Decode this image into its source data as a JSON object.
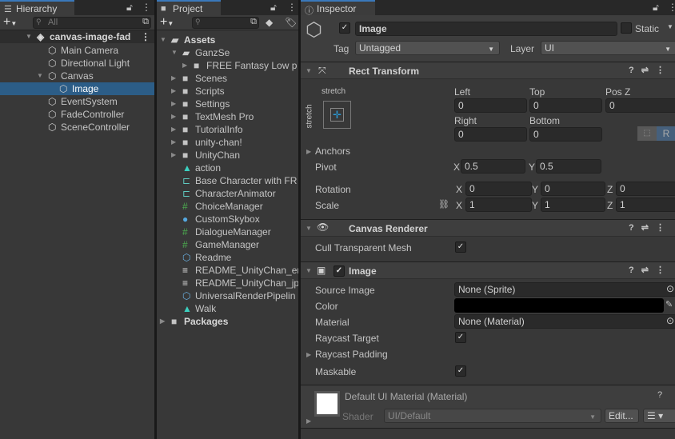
{
  "hierarchy": {
    "tab": "Hierarchy",
    "search_placeholder": "All",
    "items": [
      {
        "label": "canvas-image-fad",
        "depth": 0,
        "expanded": true,
        "icon": "unity-scene-icon",
        "bold": true
      },
      {
        "label": "Main Camera",
        "depth": 1,
        "icon": "cube-icon"
      },
      {
        "label": "Directional Light",
        "depth": 1,
        "icon": "cube-icon"
      },
      {
        "label": "Canvas",
        "depth": 1,
        "expanded": true,
        "icon": "cube-icon"
      },
      {
        "label": "Image",
        "depth": 2,
        "icon": "cube-icon",
        "selected": true
      },
      {
        "label": "EventSystem",
        "depth": 1,
        "icon": "cube-icon"
      },
      {
        "label": "FadeController",
        "depth": 1,
        "icon": "cube-icon"
      },
      {
        "label": "SceneController",
        "depth": 1,
        "icon": "cube-icon"
      }
    ]
  },
  "project": {
    "tab": "Project",
    "items": [
      {
        "label": "Assets",
        "depth": 0,
        "expanded": true,
        "icon": "folder-open-icon",
        "bold": true
      },
      {
        "label": "GanzSe",
        "depth": 1,
        "expanded": true,
        "icon": "folder-open-icon"
      },
      {
        "label": "FREE Fantasy Low p",
        "depth": 2,
        "collapsed": true,
        "icon": "folder-icon"
      },
      {
        "label": "Scenes",
        "depth": 1,
        "collapsed": true,
        "icon": "folder-icon"
      },
      {
        "label": "Scripts",
        "depth": 1,
        "collapsed": true,
        "icon": "folder-icon"
      },
      {
        "label": "Settings",
        "depth": 1,
        "collapsed": true,
        "icon": "folder-icon"
      },
      {
        "label": "TextMesh Pro",
        "depth": 1,
        "collapsed": true,
        "icon": "folder-icon"
      },
      {
        "label": "TutorialInfo",
        "depth": 1,
        "collapsed": true,
        "icon": "folder-icon"
      },
      {
        "label": "unity-chan!",
        "depth": 1,
        "collapsed": true,
        "icon": "folder-icon"
      },
      {
        "label": "UnityChan",
        "depth": 1,
        "collapsed": true,
        "icon": "folder-icon"
      },
      {
        "label": "action",
        "depth": 1,
        "icon": "animation-clip-icon"
      },
      {
        "label": "Base Character with FR",
        "depth": 1,
        "icon": "animator-controller-icon"
      },
      {
        "label": "CharacterAnimator",
        "depth": 1,
        "icon": "animator-controller-icon"
      },
      {
        "label": "ChoiceManager",
        "depth": 1,
        "icon": "csharp-script-icon"
      },
      {
        "label": "CustomSkybox",
        "depth": 1,
        "icon": "material-icon"
      },
      {
        "label": "DialogueManager",
        "depth": 1,
        "icon": "csharp-script-icon"
      },
      {
        "label": "GameManager",
        "depth": 1,
        "icon": "csharp-script-icon"
      },
      {
        "label": "Readme",
        "depth": 1,
        "icon": "scriptable-object-icon"
      },
      {
        "label": "README_UnityChan_en",
        "depth": 1,
        "icon": "text-file-icon"
      },
      {
        "label": "README_UnityChan_jp",
        "depth": 1,
        "icon": "text-file-icon"
      },
      {
        "label": "UniversalRenderPipelin",
        "depth": 1,
        "icon": "scriptable-object-icon"
      },
      {
        "label": "Walk",
        "depth": 1,
        "icon": "animation-clip-icon"
      },
      {
        "label": "Packages",
        "depth": 0,
        "collapsed": true,
        "icon": "folder-icon",
        "bold": true
      }
    ]
  },
  "inspector": {
    "tab": "Inspector",
    "name": "Image",
    "static_label": "Static",
    "tag_label": "Tag",
    "tag": "Untagged",
    "layer_label": "Layer",
    "layer": "UI",
    "rect": {
      "title": "Rect Transform",
      "h_anchor": "stretch",
      "v_anchor": "stretch",
      "left_label": "Left",
      "left": "0",
      "top_label": "Top",
      "top": "0",
      "posz_label": "Pos Z",
      "posz": "0",
      "right_label": "Right",
      "right": "0",
      "bottom_label": "Bottom",
      "bottom": "0",
      "r_button": "R",
      "anchors": "Anchors",
      "pivot": "Pivot",
      "pivot_x": "0.5",
      "pivot_y": "0.5",
      "rotation": "Rotation",
      "rot_x": "0",
      "rot_y": "0",
      "rot_z": "0",
      "scale": "Scale",
      "scale_x": "1",
      "scale_y": "1",
      "scale_z": "1",
      "x": "X",
      "y": "Y",
      "z": "Z"
    },
    "canvas_renderer": {
      "title": "Canvas Renderer",
      "cull_label": "Cull Transparent Mesh",
      "cull": true
    },
    "image": {
      "title": "Image",
      "source_label": "Source Image",
      "source": "None (Sprite)",
      "color_label": "Color",
      "color": "#000000",
      "material_label": "Material",
      "material": "None (Material)",
      "raycast_target_label": "Raycast Target",
      "raycast_padding_label": "Raycast Padding",
      "maskable_label": "Maskable"
    },
    "material": {
      "title": "Default UI Material (Material)",
      "shader_label": "Shader",
      "shader": "UI/Default",
      "edit": "Edit..."
    }
  },
  "colors": {
    "selection": "#2c5d87",
    "accent": "#3a79bb"
  }
}
